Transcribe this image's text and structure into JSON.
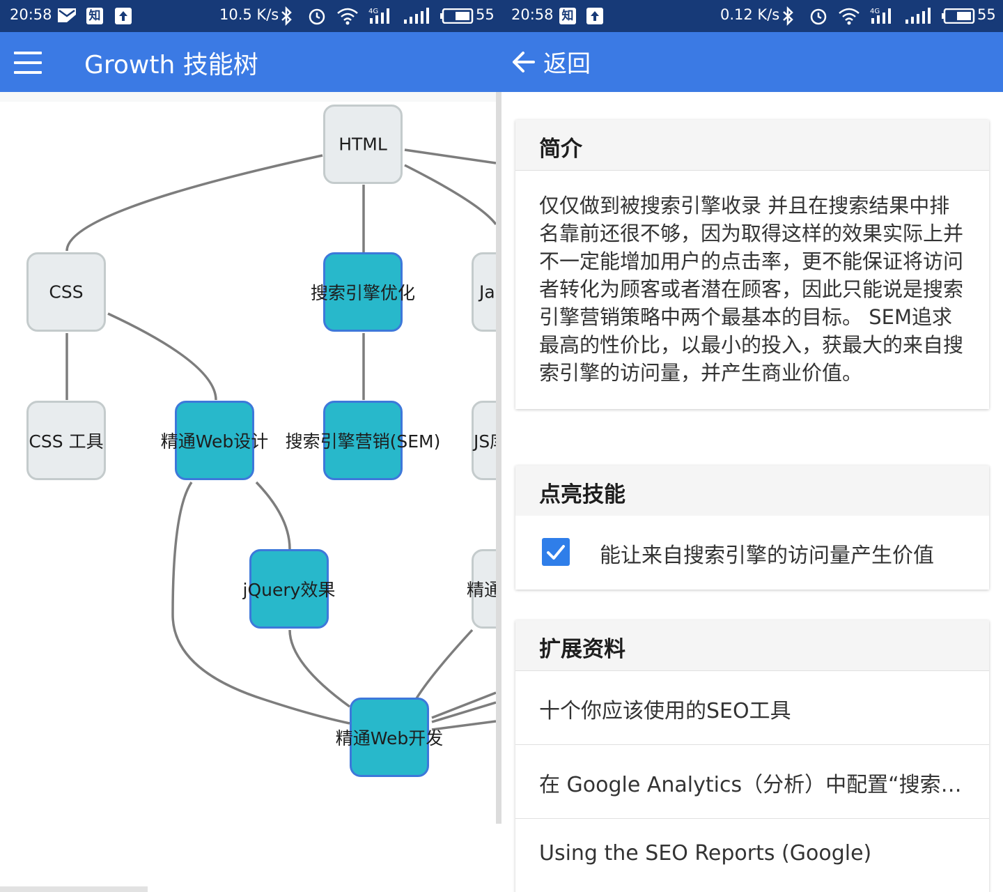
{
  "left_status": {
    "time": "20:58",
    "zhihu": "知",
    "speed": "10.5 K/s",
    "network": "4G",
    "battery": "55"
  },
  "right_status": {
    "time": "20:58",
    "zhihu": "知",
    "speed": "0.12 K/s",
    "network": "4G",
    "battery": "55"
  },
  "left_appbar": {
    "title": "Growth 技能树"
  },
  "right_appbar": {
    "back_label": "返回"
  },
  "skill_tree": {
    "nodes": [
      {
        "id": "html",
        "label": "HTML",
        "state": "grey"
      },
      {
        "id": "css",
        "label": "CSS",
        "state": "grey"
      },
      {
        "id": "seo",
        "label": "搜索引擎优化",
        "state": "teal"
      },
      {
        "id": "js",
        "label": "Ja",
        "state": "grey"
      },
      {
        "id": "css-tools",
        "label": "CSS 工具",
        "state": "grey"
      },
      {
        "id": "web-design",
        "label": "精通Web设计",
        "state": "teal"
      },
      {
        "id": "sem",
        "label": "搜索引擎营销(SEM)",
        "state": "teal"
      },
      {
        "id": "js-lib",
        "label": "JS库",
        "state": "grey"
      },
      {
        "id": "jquery",
        "label": "jQuery效果",
        "state": "teal"
      },
      {
        "id": "expert",
        "label": "精通",
        "state": "grey"
      },
      {
        "id": "web-dev",
        "label": "精通Web开发",
        "state": "teal"
      }
    ],
    "colors": {
      "grey_fill": "#e8ecee",
      "grey_border": "#c4cbcc",
      "teal_fill": "#28b8cb",
      "teal_border": "#3d78da",
      "edge": "#7d7d7d"
    }
  },
  "intro": {
    "title": "简介",
    "text": "仅仅做到被搜索引擎收录 并且在搜索结果中排名靠前还很不够，因为取得这样的效果实际上并不一定能增加用户的点击率，更不能保证将访问者转化为顾客或者潜在顾客，因此只能说是搜索引擎营销策略中两个最基本的目标。 SEM追求最高的性价比，以最小的投入，获最大的来自搜索引擎的访问量，并产生商业价值。"
  },
  "skills": {
    "title": "点亮技能",
    "items": [
      {
        "label": "能让来自搜索引擎的访问量产生价值",
        "checked": true
      }
    ]
  },
  "resources": {
    "title": "扩展资料",
    "links": [
      "十个你应该使用的SEO工具",
      "在 Google Analytics（分析）中配置“搜索…",
      "Using the SEO Reports (Google)"
    ]
  },
  "theme": {
    "status_bar": "#173a78",
    "app_bar": "#3b7ae4",
    "checkbox": "#2f7ee9"
  }
}
